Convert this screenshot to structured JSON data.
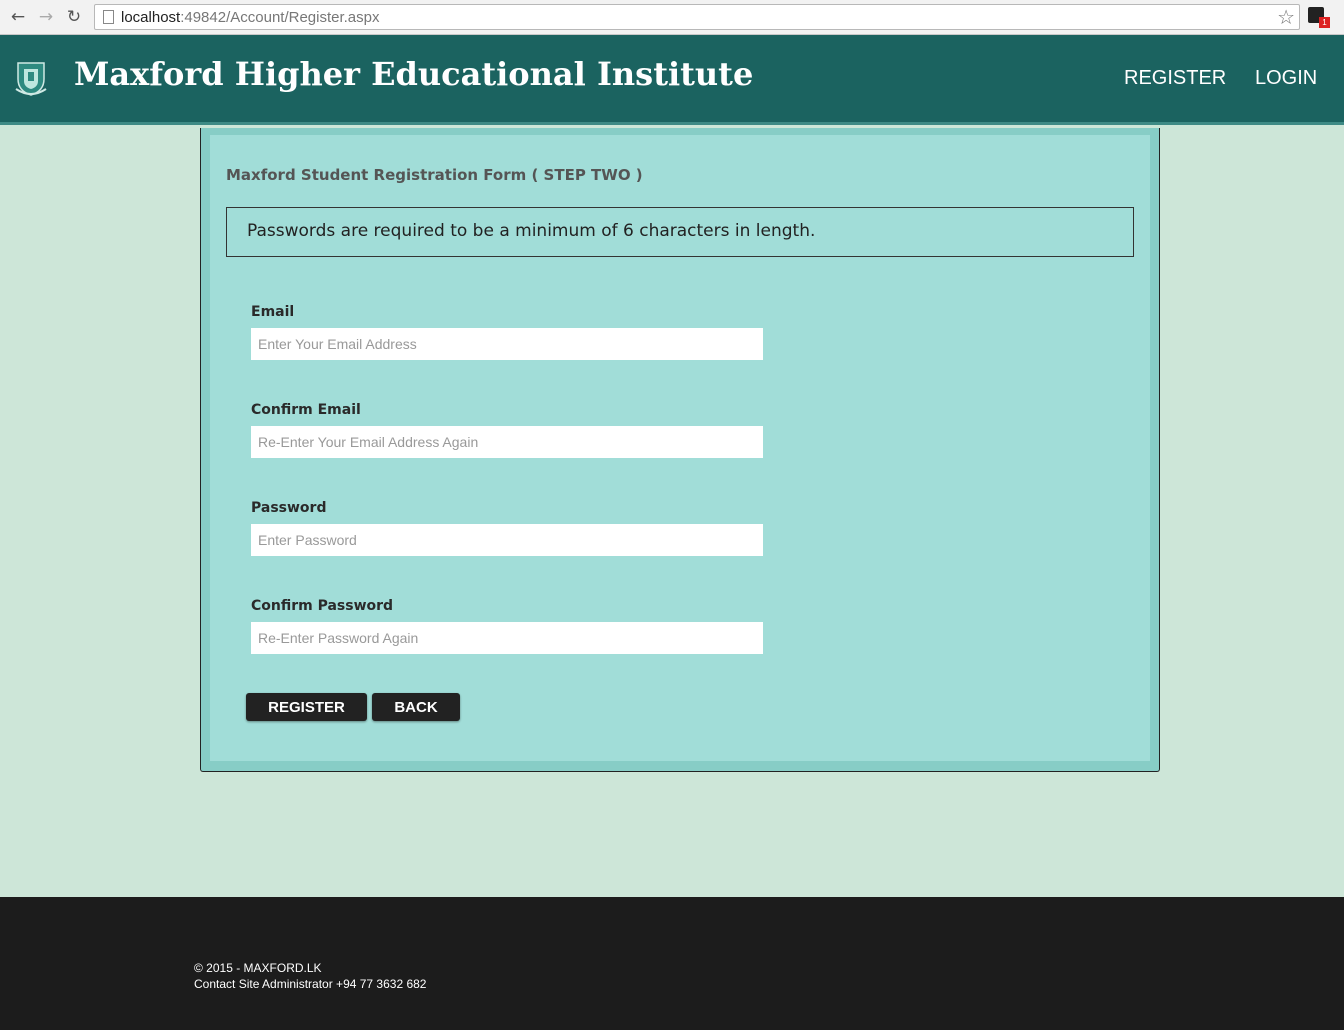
{
  "browser": {
    "url_host": "localhost",
    "url_rest": ":49842/Account/Register.aspx",
    "ext_badge": "1"
  },
  "header": {
    "site_title": "Maxford Higher Educational Institute",
    "nav": {
      "register": "REGISTER",
      "login": "LOGIN"
    }
  },
  "form": {
    "title": "Maxford Student Registration Form ( STEP TWO )",
    "notice": "Passwords are required to be a minimum of 6 characters in length.",
    "fields": [
      {
        "label": "Email",
        "value": "",
        "placeholder": "Enter Your Email Address"
      },
      {
        "label": "Confirm Email",
        "value": "",
        "placeholder": "Re-Enter Your Email Address Again"
      },
      {
        "label": "Password",
        "value": "",
        "placeholder": "Enter Password"
      },
      {
        "label": "Confirm Password",
        "value": "",
        "placeholder": "Re-Enter Password Again"
      }
    ],
    "buttons": {
      "register": "REGISTER",
      "back": "BACK"
    }
  },
  "footer": {
    "copyright": "© 2015 - MAXFORD.LK",
    "contact": "Contact Site Administrator +94 77 3632 682"
  },
  "colors": {
    "header_bg": "#1b6360",
    "page_bg": "#cde6d8",
    "panel_bg": "#a1ddd8",
    "footer_bg": "#1c1c1c",
    "button_bg": "#222222"
  }
}
